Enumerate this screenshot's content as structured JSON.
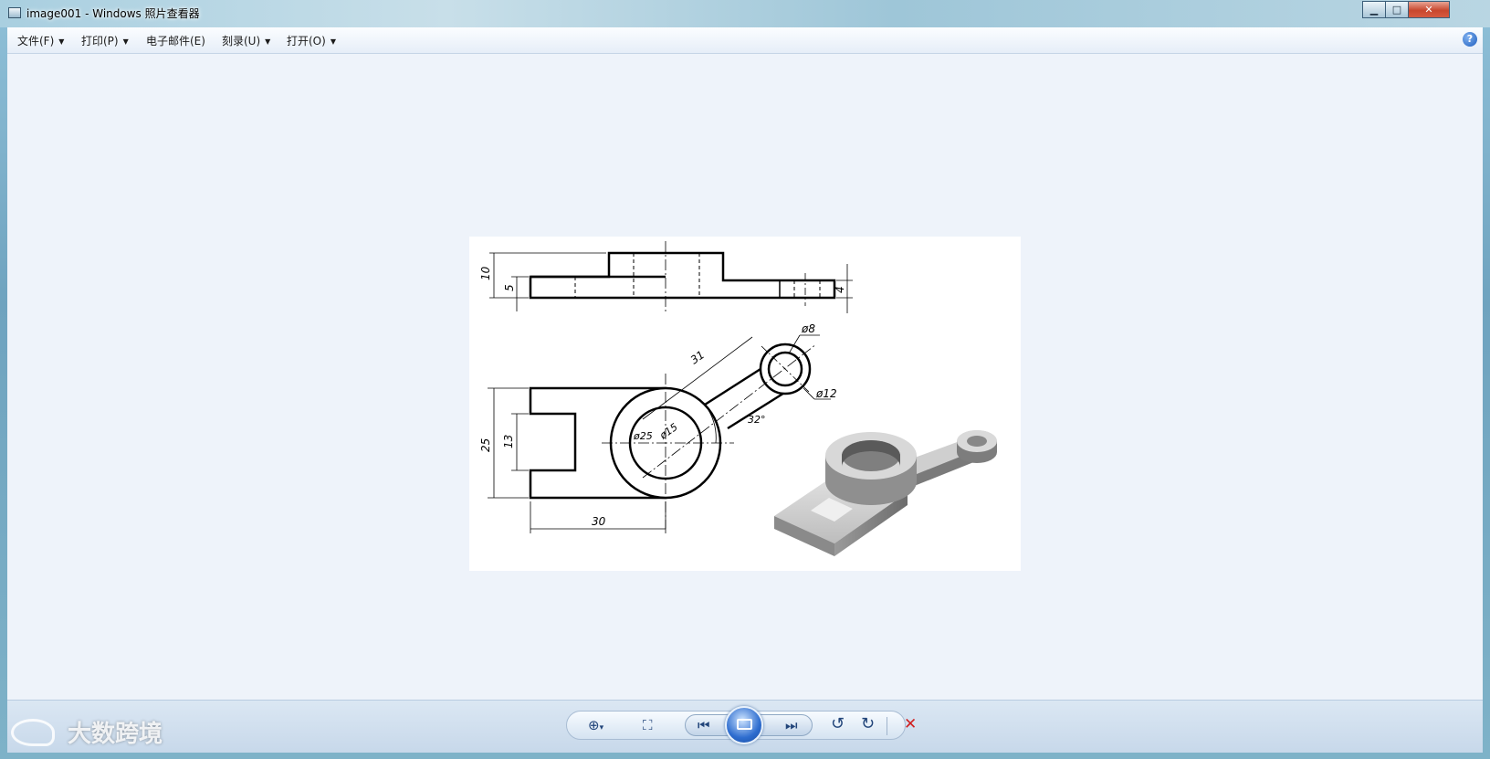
{
  "window": {
    "title": "image001 - Windows 照片查看器",
    "controls": {
      "minimize": "▁",
      "maximize": "□",
      "close": "✕"
    }
  },
  "menubar": {
    "items": [
      {
        "label": "文件(F)"
      },
      {
        "label": "打印(P)"
      },
      {
        "label": "电子邮件(E)"
      },
      {
        "label": "刻录(U)"
      },
      {
        "label": "打开(O)"
      }
    ],
    "dropdown_arrow": "▼",
    "help_glyph": "?"
  },
  "drawing": {
    "dim_10": "10",
    "dim_5": "5",
    "dim_4": "4",
    "dim_25": "25",
    "dim_13": "13",
    "dim_30": "30",
    "dim_31": "31",
    "dim_phi8": "ø8",
    "dim_phi12": "ø12",
    "dim_phi25": "ø25",
    "dim_phi15": "ø15",
    "dim_angle": "32°"
  },
  "toolbar": {
    "zoom_glyph": "⊕",
    "zoom_arrow": "▾",
    "fit_glyph": "⛶",
    "prev_glyph": "⏮",
    "next_glyph": "⏭",
    "rotate_ccw_glyph": "↺",
    "rotate_cw_glyph": "↻",
    "delete_glyph": "✕"
  },
  "watermark": {
    "text": "大数跨境"
  },
  "colors": {
    "viewer_bg": "#eef3fa",
    "close_red": "#c8472e",
    "delete_red": "#d02020"
  }
}
